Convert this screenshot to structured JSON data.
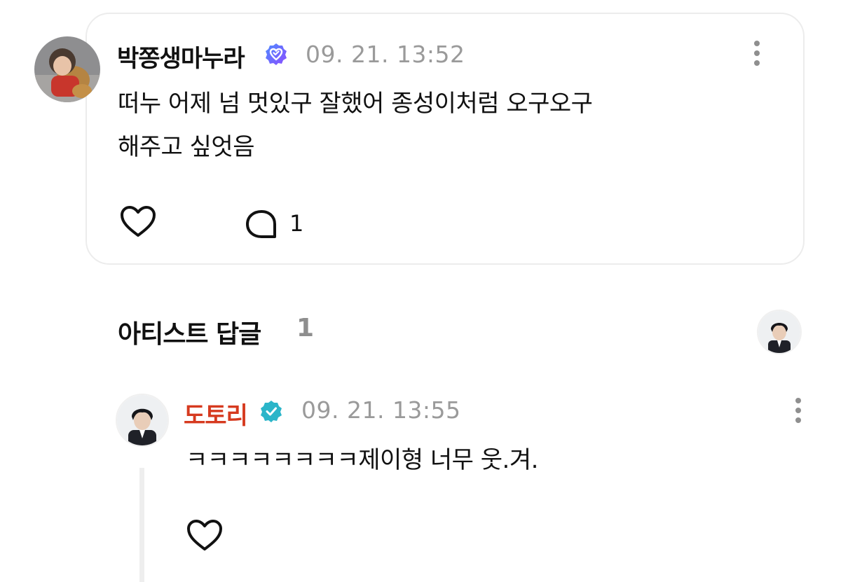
{
  "comment": {
    "author": "박쫑생마누라",
    "timestamp": "09. 21. 13:52",
    "text_line1": "떠누 어제 넘 멋있구 잘했어 종성이처럼 오구오구",
    "text_line2": "해주고 싶엇음",
    "reply_count": "1",
    "badge_color": "#6a5cf6",
    "icons": [
      "verified-badge-icon",
      "more-vertical-icon",
      "heart-icon",
      "reply-bubble-icon"
    ]
  },
  "artist_replies": {
    "title": "아티스트 답글",
    "count": "1"
  },
  "reply": {
    "author": "도토리",
    "author_color": "#d63a1f",
    "badge_color": "#2bb5c9",
    "timestamp": "09. 21. 13:55",
    "text": "ㅋㅋㅋㅋㅋㅋㅋㅋ제이형 너무 웃.겨.",
    "icons": [
      "verified-badge-icon",
      "more-vertical-icon",
      "heart-icon"
    ]
  }
}
